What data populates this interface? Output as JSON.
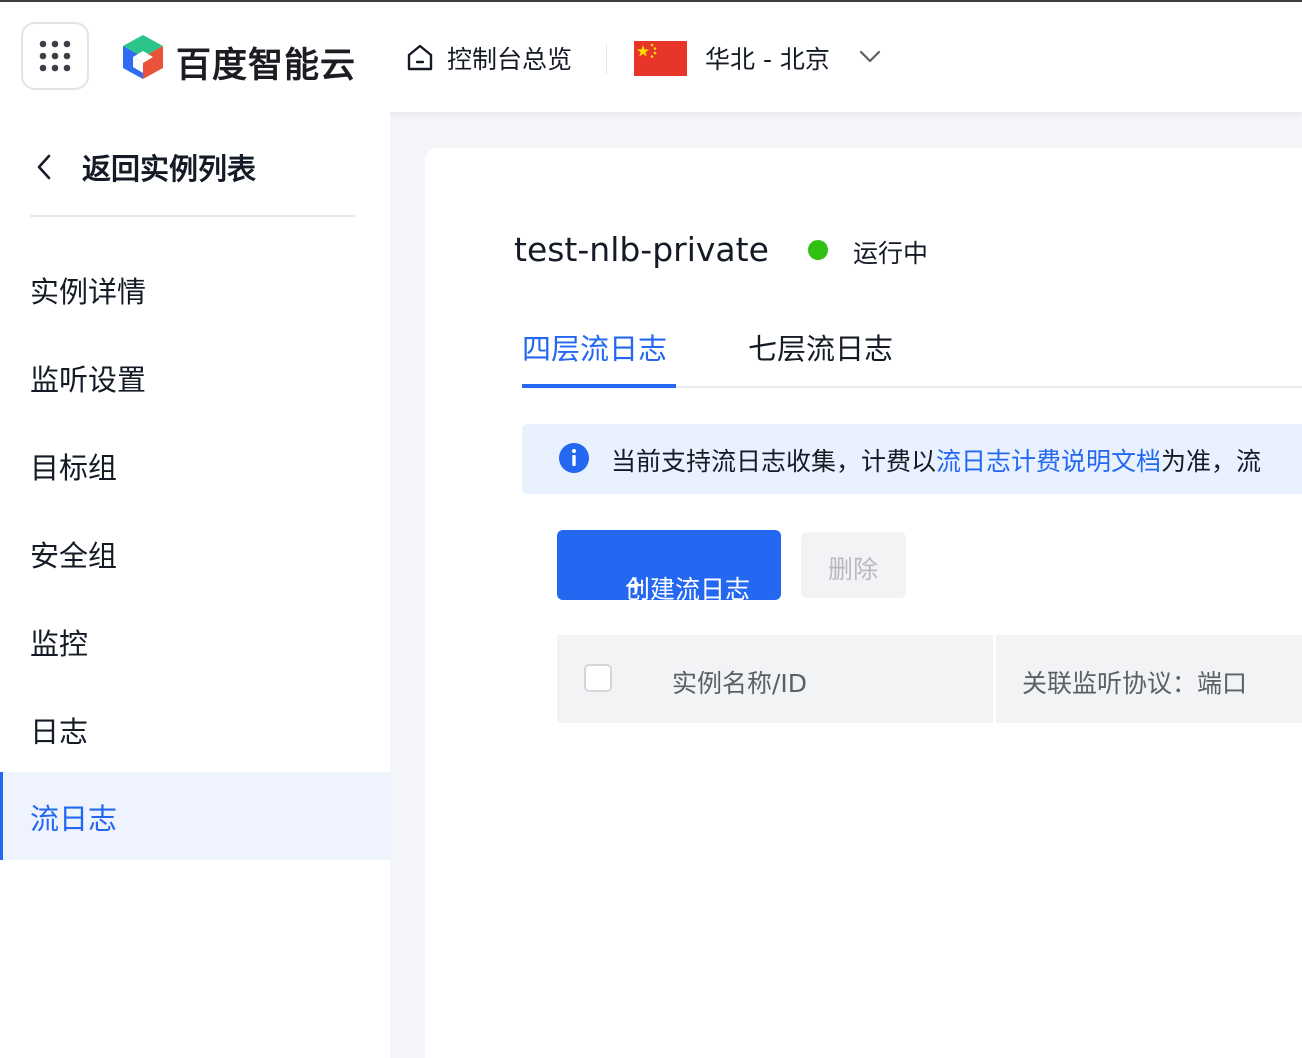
{
  "header": {
    "brand": "百度智能云",
    "console_label": "控制台总览",
    "region_label": "华北 - 北京"
  },
  "sidebar": {
    "back_label": "返回实例列表",
    "items": [
      {
        "label": "实例详情"
      },
      {
        "label": "监听设置"
      },
      {
        "label": "目标组"
      },
      {
        "label": "安全组"
      },
      {
        "label": "监控"
      },
      {
        "label": "日志"
      },
      {
        "label": "流日志",
        "active": true
      }
    ]
  },
  "instance": {
    "name": "test-nlb-private",
    "status": "运行中",
    "status_color": "#30bf13"
  },
  "tabs": [
    {
      "label": "四层流日志",
      "active": true
    },
    {
      "label": "七层流日志"
    }
  ],
  "notice": {
    "prefix": "当前支持流日志收集，计费以",
    "link": "流日志计费说明文档",
    "suffix": "为准，流"
  },
  "toolbar": {
    "create_plus": "+",
    "create_label": "创建流日志",
    "delete_label": "删除"
  },
  "table": {
    "columns": [
      "实例名称/ID",
      "关联监听协议：端口"
    ]
  },
  "colors": {
    "accent": "#2468f2",
    "nav_active_bg": "#eef3fe",
    "notice_bg": "#eaf1fe"
  }
}
